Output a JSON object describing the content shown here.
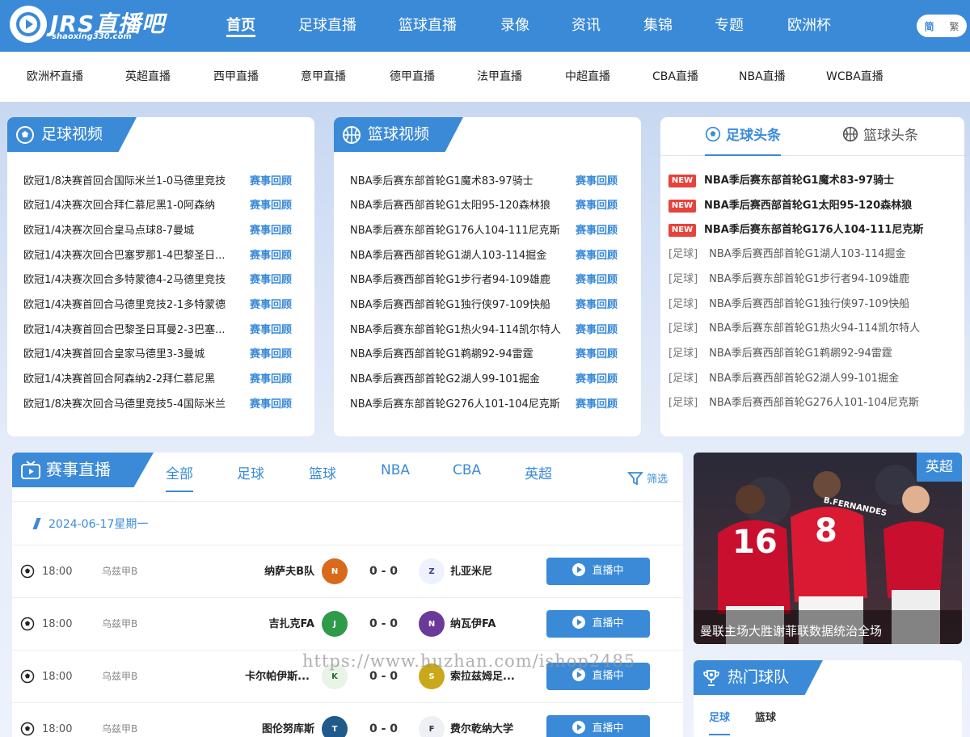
{
  "header": {
    "logo_title": "JRS直播吧",
    "logo_sub": "shaoxing330.com",
    "nav": [
      "首页",
      "足球直播",
      "篮球直播",
      "录像",
      "资讯",
      "集锦",
      "专题",
      "欧洲杯"
    ],
    "lang": {
      "simplified": "简",
      "traditional": "繁"
    }
  },
  "subnav": [
    "欧洲杯直播",
    "英超直播",
    "西甲直播",
    "意甲直播",
    "德甲直播",
    "法甲直播",
    "中超直播",
    "CBA直播",
    "NBA直播",
    "WCBA直播"
  ],
  "football_video": {
    "title": "足球视频",
    "link_label": "赛事回顾",
    "items": [
      "欧冠1/8决赛首回合国际米兰1-0马德里竞技",
      "欧冠1/4决赛次回合拜仁慕尼黑1-0阿森纳",
      "欧冠1/4决赛次回合皇马点球8-7曼城",
      "欧冠1/4决赛次回合巴塞罗那1-4巴黎圣日...",
      "欧冠1/4决赛次回合多特蒙德4-2马德里竞技",
      "欧冠1/4决赛首回合马德里竞技2-1多特蒙德",
      "欧冠1/4决赛首回合巴黎圣日耳曼2-3巴塞...",
      "欧冠1/4决赛首回合皇家马德里3-3曼城",
      "欧冠1/4决赛首回合阿森纳2-2拜仁慕尼黑",
      "欧冠1/8决赛次回合马德里竞技5-4国际米兰"
    ]
  },
  "basketball_video": {
    "title": "篮球视频",
    "link_label": "赛事回顾",
    "items": [
      "NBA季后赛东部首轮G1魔术83-97骑士",
      "NBA季后赛西部首轮G1太阳95-120森林狼",
      "NBA季后赛东部首轮G176人104-111尼克斯",
      "NBA季后赛西部首轮G1湖人103-114掘金",
      "NBA季后赛西部首轮G1步行者94-109雄鹿",
      "NBA季后赛西部首轮G1独行侠97-109快船",
      "NBA季后赛东部首轮G1热火94-114凯尔特人",
      "NBA季后赛西部首轮G1鹈鹕92-94雷霆",
      "NBA季后赛西部首轮G2湖人99-101掘金",
      "NBA季后赛东部首轮G276人101-104尼克斯"
    ]
  },
  "headlines": {
    "tab_football": "足球头条",
    "tab_basketball": "篮球头条",
    "new_label": "NEW",
    "hot_items": [
      "NBA季后赛东部首轮G1魔术83-97骑士",
      "NBA季后赛西部首轮G1太阳95-120森林狼",
      "NBA季后赛东部首轮G176人104-111尼克斯"
    ],
    "tag": "[足球]",
    "items": [
      "NBA季后赛西部首轮G1湖人103-114掘金",
      "NBA季后赛东部首轮G1步行者94-109雄鹿",
      "NBA季后赛西部首轮G1独行侠97-109快船",
      "NBA季后赛东部首轮G1热火94-114凯尔特人",
      "NBA季后赛西部首轮G1鹈鹕92-94雷霆",
      "NBA季后赛西部首轮G2湖人99-101掘金",
      "NBA季后赛西部首轮G276人101-104尼克斯"
    ]
  },
  "live": {
    "title": "赛事直播",
    "filters": [
      "全部",
      "足球",
      "篮球",
      "NBA",
      "CBA",
      "英超"
    ],
    "filter_button": "筛选",
    "date": "2024-06-17星期一",
    "live_label": "直播中",
    "matches": [
      {
        "time": "18:00",
        "league": "乌兹甲B",
        "home": "纳萨夫B队",
        "score": "0 - 0",
        "away": "扎亚米尼"
      },
      {
        "time": "18:00",
        "league": "乌兹甲B",
        "home": "吉扎克FA",
        "score": "0 - 0",
        "away": "纳瓦伊FA"
      },
      {
        "time": "18:00",
        "league": "乌兹甲B",
        "home": "卡尔帕伊斯...",
        "score": "0 - 0",
        "away": "索拉兹姆足..."
      },
      {
        "time": "18:00",
        "league": "乌兹甲B",
        "home": "图伦努库斯",
        "score": "0 - 0",
        "away": "费尔乾纳大学"
      }
    ]
  },
  "feature": {
    "badge": "英超",
    "caption": "曼联主场大胜谢菲联数据统治全场",
    "jersey_left": "16",
    "jersey_mid": "8",
    "jersey_name": "B.FERNANDES"
  },
  "hot_teams": {
    "title": "热门球队",
    "tabs": [
      "足球",
      "篮球"
    ]
  },
  "watermark": "https://www.huzhan.com/ishop2485"
}
